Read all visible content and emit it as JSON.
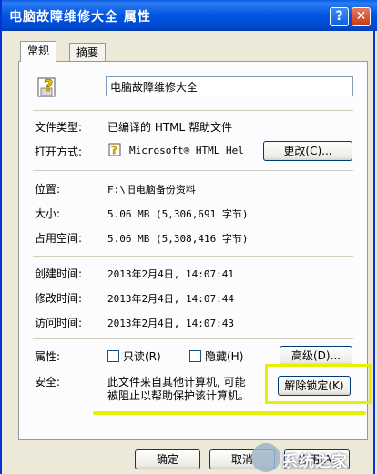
{
  "window": {
    "title": "电脑故障维修大全 属性",
    "help_button": "?",
    "close_button": "✕"
  },
  "tabs": [
    {
      "label": "常规"
    },
    {
      "label": "摘要"
    }
  ],
  "general": {
    "file_name": "电脑故障维修大全",
    "file_type": {
      "label": "文件类型:",
      "value": "已编译的 HTML 帮助文件"
    },
    "opens_with": {
      "label": "打开方式:",
      "value": "Microsoft® HTML Hel",
      "change_button": "更改(C)..."
    },
    "location": {
      "label": "位置:",
      "value": "F:\\旧电脑备份资料"
    },
    "size": {
      "label": "大小:",
      "value": "5.06 MB (5,306,691 字节)"
    },
    "size_on_disk": {
      "label": "占用空间:",
      "value": "5.06 MB (5,308,416 字节)"
    },
    "created": {
      "label": "创建时间:",
      "value": "2013年2月4日, 14:07:41"
    },
    "modified": {
      "label": "修改时间:",
      "value": "2013年2月4日, 14:07:44"
    },
    "accessed": {
      "label": "访问时间:",
      "value": "2013年2月4日, 14:07:43"
    },
    "attributes": {
      "label": "属性:",
      "readonly": "只读(R)",
      "hidden": "隐藏(H)",
      "advanced_button": "高级(D)...",
      "readonly_checked": false,
      "hidden_checked": false
    },
    "security": {
      "label": "安全:",
      "text_line1": "此文件来自其他计算机, 可能",
      "text_line2": "被阻止以帮助保护该计算机。",
      "unblock_button": "解除锁定(K)"
    }
  },
  "buttons": {
    "ok": "确定",
    "cancel": "取消",
    "apply": "应用(A)"
  },
  "watermark": {
    "text": "系统之家"
  },
  "colors": {
    "titlebar": "#0054e3",
    "highlight": "#e6f000",
    "dialog_bg": "#ece9d8"
  }
}
